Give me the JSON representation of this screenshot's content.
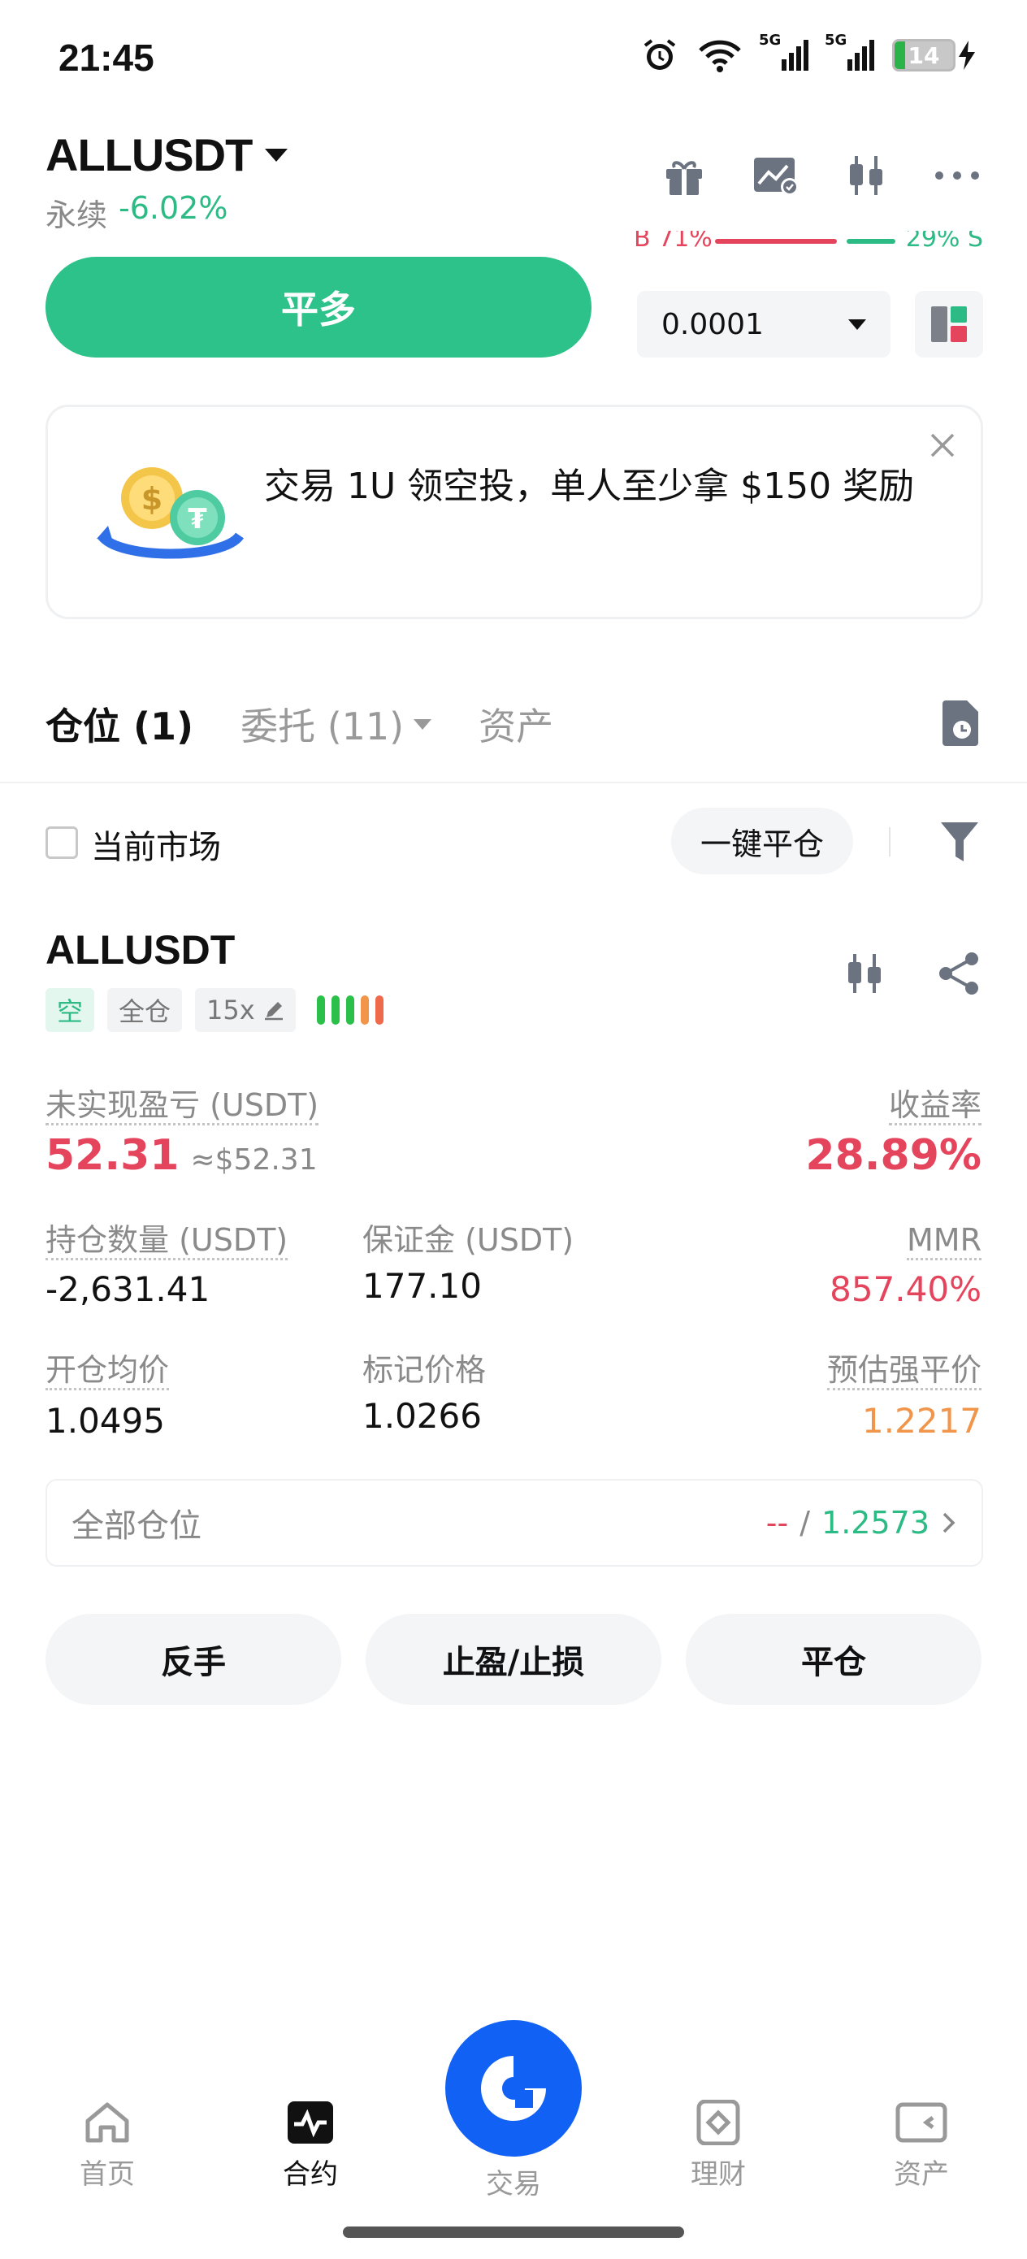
{
  "status_bar": {
    "time": "21:45",
    "battery": "14",
    "network_1": "5G",
    "network_2": "5G"
  },
  "header": {
    "pair": "ALLUSDT",
    "type": "永续",
    "change": "-6.02%"
  },
  "ratio": {
    "buy": "B 71%",
    "sell": "29% S"
  },
  "actions": {
    "close_long": "平多",
    "step": "0.0001"
  },
  "promo": {
    "text": "交易 1U 领空投，单人至少拿 $150 奖励"
  },
  "tabs": [
    {
      "label": "仓位 (1)"
    },
    {
      "label": "委托 (11)"
    },
    {
      "label": "资产"
    }
  ],
  "filter": {
    "current_market": "当前市场",
    "close_all": "一键平仓"
  },
  "position": {
    "symbol": "ALLUSDT",
    "side": "空",
    "margin_mode": "全仓",
    "leverage": "15x",
    "risk_colors": [
      "#2bc04a",
      "#2bc04a",
      "#2bc04a",
      "#f0954a",
      "#ee6a4a"
    ],
    "unrealized_pnl_label": "未实现盈亏 (USDT)",
    "unrealized_pnl": "52.31",
    "unrealized_pnl_approx": "≈$52.31",
    "roe_label": "收益率",
    "roe": "28.89%",
    "size_label": "持仓数量 (USDT)",
    "size": "-2,631.41",
    "margin_label": "保证金 (USDT)",
    "margin": "177.10",
    "mmr_label": "MMR",
    "mmr": "857.40%",
    "entry_label": "开仓均价",
    "entry": "1.0495",
    "mark_label": "标记价格",
    "mark": "1.0266",
    "liq_label": "预估强平价",
    "liq": "1.2217",
    "all_positions_label": "全部仓位",
    "all_positions_left": "--",
    "all_positions_sep": "/",
    "all_positions_right": "1.2573"
  },
  "position_actions": {
    "reverse": "反手",
    "tpsl": "止盈/止损",
    "close": "平仓"
  },
  "nav": [
    {
      "label": "首页",
      "icon": "home-icon"
    },
    {
      "label": "合约",
      "icon": "futures-icon"
    },
    {
      "label": "交易",
      "icon": "trade-icon"
    },
    {
      "label": "理财",
      "icon": "earn-icon"
    },
    {
      "label": "资产",
      "icon": "wallet-icon"
    }
  ]
}
